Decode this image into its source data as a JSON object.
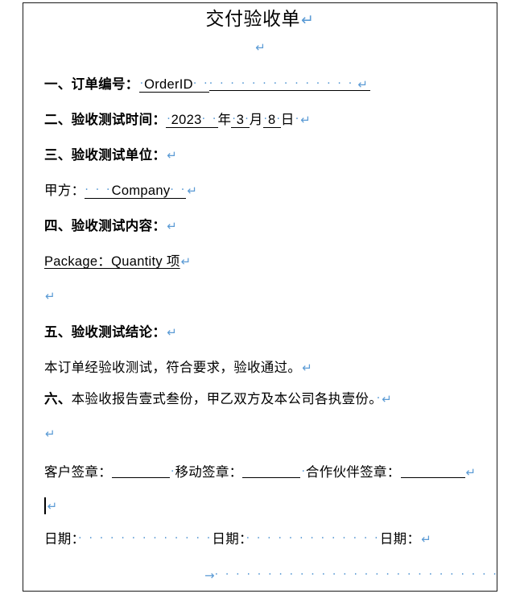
{
  "document": {
    "title": "交付验收单",
    "sections": {
      "order": {
        "heading": "一、订单编号：",
        "value": "OrderID"
      },
      "test_time": {
        "heading": "二、验收测试时间：",
        "year_value": "2023",
        "year_unit": "年",
        "month_value": "3",
        "month_unit": "月",
        "day_value": "8",
        "day_unit": "日"
      },
      "test_unit": {
        "heading": "三、验收测试单位："
      },
      "party_a": {
        "label": "甲方：",
        "value": "Company"
      },
      "test_content": {
        "heading": "四、验收测试内容：",
        "item": "Package：Quantity 项"
      },
      "conclusion": {
        "heading": "五、验收测试结论：",
        "body": "本订单经验收测试，符合要求，验收通过。"
      },
      "copies": {
        "heading": "六、",
        "body": "本验收报告壹式叁份，甲乙双方及本公司各执壹份。"
      },
      "signatures": {
        "customer_label": "客户签章：",
        "mobile_label": "移动签章：",
        "partner_label": "合作伙伴签章："
      },
      "dates": {
        "label_1": "日期：",
        "label_2": "日期：",
        "label_3": "日期："
      }
    }
  },
  "formatting_marks": {
    "pilcrow": "↵",
    "space_dot": "·",
    "tab_arrow": "→",
    "color": "#5b9bd5"
  },
  "page": {
    "border_color": "#1a1a1a",
    "background": "#ffffff",
    "text_color": "#000000"
  }
}
